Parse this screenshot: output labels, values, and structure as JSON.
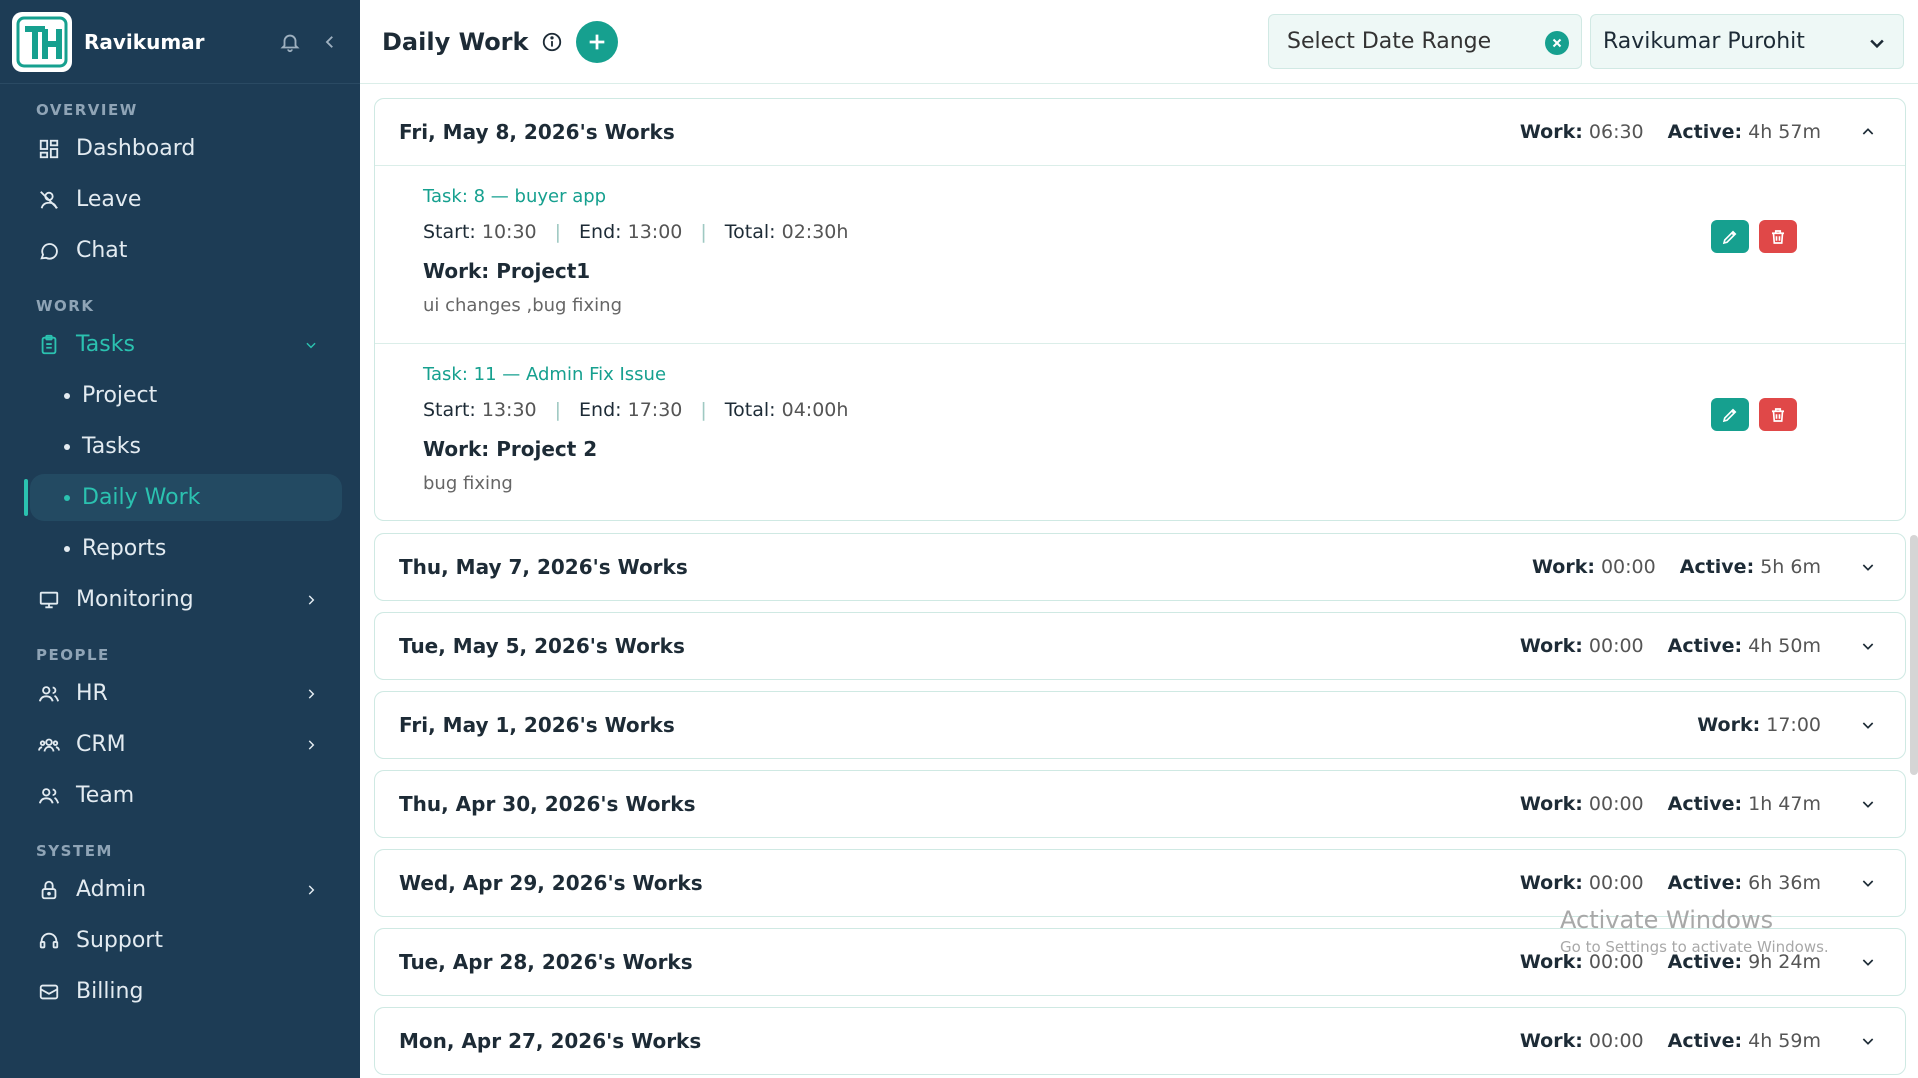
{
  "brand": {
    "name": "Ravikumar",
    "logo_letters": "TH"
  },
  "sidebar": {
    "sections": {
      "overview": "OVERVIEW",
      "work": "WORK",
      "people": "PEOPLE",
      "system": "SYSTEM"
    },
    "items": {
      "dashboard": "Dashboard",
      "leave": "Leave",
      "chat": "Chat",
      "tasks": "Tasks",
      "project": "Project",
      "tasks_sub": "Tasks",
      "daily_work": "Daily Work",
      "reports": "Reports",
      "monitoring": "Monitoring",
      "hr": "HR",
      "crm": "CRM",
      "team": "Team",
      "admin": "Admin",
      "support": "Support",
      "billing": "Billing"
    }
  },
  "header": {
    "title": "Daily Work",
    "date_range_placeholder": "Select Date Range",
    "user_selected": "Ravikumar Purohit"
  },
  "labels": {
    "work": "Work:",
    "active": "Active:",
    "start": "Start:",
    "end": "End:",
    "total": "Total:"
  },
  "days": [
    {
      "title": "Fri, May 8, 2026's Works",
      "work": "06:30",
      "active": "4h 57m",
      "expanded": true,
      "tasks": [
        {
          "title": "Task: 8 — buyer app",
          "start": "10:30",
          "end": "13:00",
          "total": "02:30h",
          "work": "Work: Project1",
          "desc": "ui changes ,bug fixing"
        },
        {
          "title": "Task: 11 — Admin Fix Issue",
          "start": "13:30",
          "end": "17:30",
          "total": "04:00h",
          "work": "Work: Project 2",
          "desc": "bug fixing"
        }
      ]
    },
    {
      "title": "Thu, May 7, 2026's Works",
      "work": "00:00",
      "active": "5h 6m"
    },
    {
      "title": "Tue, May 5, 2026's Works",
      "work": "00:00",
      "active": "4h 50m"
    },
    {
      "title": "Fri, May 1, 2026's Works",
      "work": "17:00"
    },
    {
      "title": "Thu, Apr 30, 2026's Works",
      "work": "00:00",
      "active": "1h 47m"
    },
    {
      "title": "Wed, Apr 29, 2026's Works",
      "work": "00:00",
      "active": "6h 36m"
    },
    {
      "title": "Tue, Apr 28, 2026's Works",
      "work": "00:00",
      "active": "9h 24m"
    },
    {
      "title": "Mon, Apr 27, 2026's Works",
      "work": "00:00",
      "active": "4h 59m"
    }
  ],
  "watermark": {
    "line1": "Activate Windows",
    "line2": "Go to Settings to activate Windows."
  },
  "colors": {
    "sidebar_bg": "#1d3c55",
    "accent": "#16a08f",
    "active_text": "#2bc2b0",
    "delete": "#e04848"
  }
}
